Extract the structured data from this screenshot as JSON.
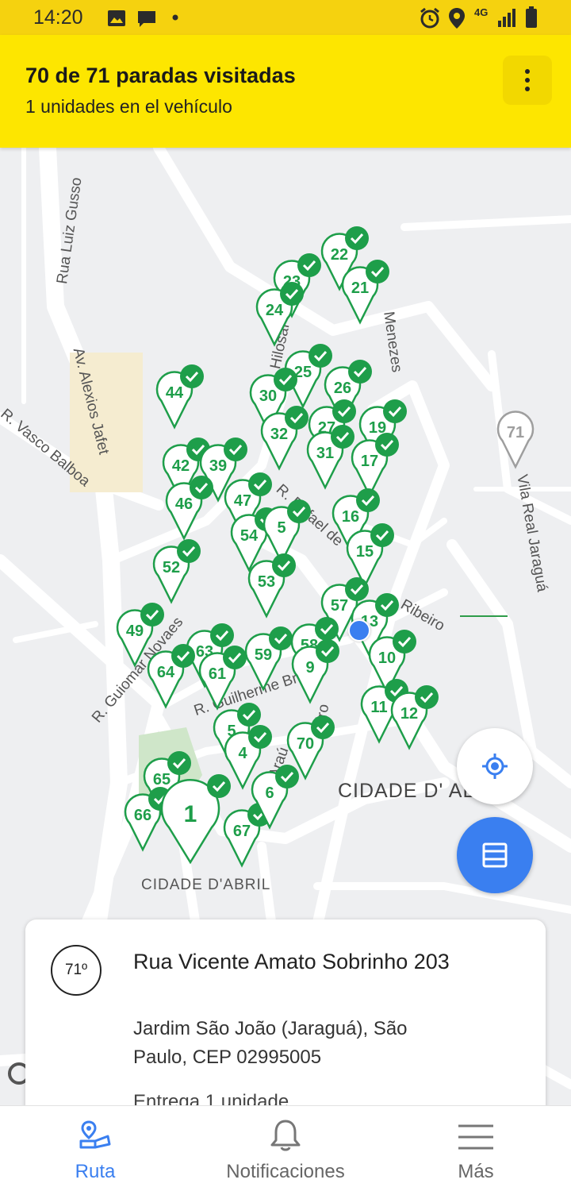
{
  "status_bar": {
    "time": "14:20",
    "network": "4G"
  },
  "header": {
    "visited": "70 de 71 paradas visitadas",
    "units": "1 unidades en el vehículo",
    "menu_icon": "more-vert-icon"
  },
  "map": {
    "streets": [
      "Rua Luiz Gusso",
      "Av. Alexios Jafet",
      "R. Vasco Balboa",
      "R. Guiomar Novaes",
      "R. Guilherme Br",
      "R. Hilosaf",
      "R. Rafael de",
      "Ribeiro",
      "Menezes",
      "Vila Real Jaraguá",
      "Araú",
      "iro"
    ],
    "districts": [
      "CIDADE D'ABRIL",
      "CIDADE D' AB"
    ],
    "pin_color_visited": "#1e9e4a",
    "pin_color_pending": "#9e9e9e",
    "location_dot_color": "#3a7ff0",
    "pins": [
      "22",
      "21",
      "23",
      "24",
      "25",
      "26",
      "44",
      "30",
      "32",
      "27",
      "19",
      "31",
      "17",
      "42",
      "39",
      "46",
      "47",
      "16",
      "54",
      "5",
      "15",
      "52",
      "53",
      "57",
      "13",
      "49",
      "63",
      "59",
      "58",
      "10",
      "64",
      "61",
      "9",
      "11",
      "12",
      "5",
      "4",
      "70",
      "65",
      "66",
      "1",
      "67",
      "6",
      "71"
    ]
  },
  "fabs": {
    "locate_icon": "my-location-icon",
    "list_icon": "list-icon"
  },
  "stop_card": {
    "number": "71º",
    "street": "Rua Vicente Amato Sobrinho 203",
    "area": "Jardim São João (Jaraguá), São Paulo, CEP 02995005",
    "delivery": "Entrega 1 unidade"
  },
  "bottom_nav": [
    {
      "label": "Ruta",
      "icon": "route-icon",
      "active": true
    },
    {
      "label": "Notificaciones",
      "icon": "bell-icon",
      "active": false
    },
    {
      "label": "Más",
      "icon": "menu-icon",
      "active": false
    }
  ],
  "colors": {
    "header_bg": "#fde600",
    "status_bg": "#f5d20f",
    "accent": "#3a7ff0",
    "visited": "#1e9e4a"
  }
}
